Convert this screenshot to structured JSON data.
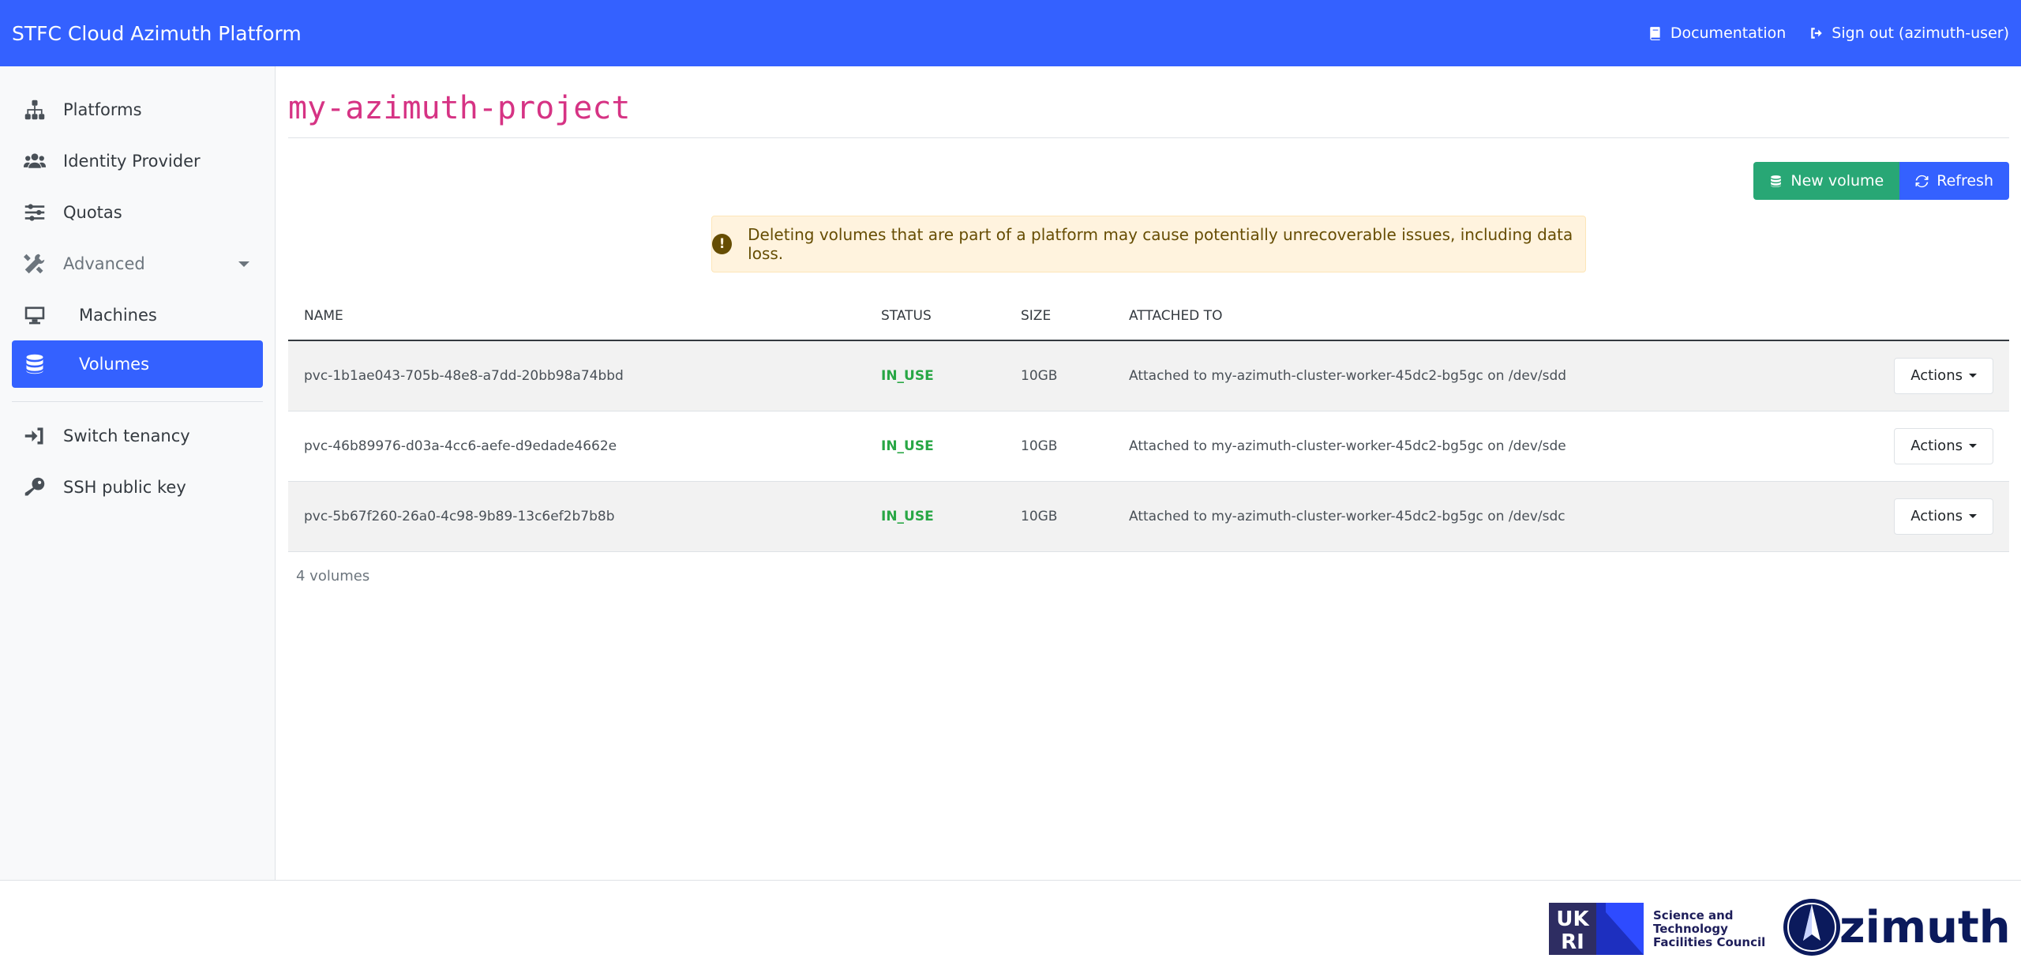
{
  "header": {
    "brand": "STFC Cloud Azimuth Platform",
    "documentation": "Documentation",
    "signout": "Sign out (azimuth-user)"
  },
  "sidebar": {
    "items": [
      {
        "label": "Platforms",
        "icon": "sitemap-icon"
      },
      {
        "label": "Identity Provider",
        "icon": "users-icon"
      },
      {
        "label": "Quotas",
        "icon": "sliders-icon"
      },
      {
        "label": "Advanced",
        "icon": "tools-icon"
      },
      {
        "label": "Machines",
        "icon": "desktop-icon"
      },
      {
        "label": "Volumes",
        "icon": "database-icon"
      },
      {
        "label": "Switch tenancy",
        "icon": "sign-in-icon"
      },
      {
        "label": "SSH public key",
        "icon": "key-icon"
      }
    ]
  },
  "main": {
    "title": "my-azimuth-project",
    "new_volume": "New volume",
    "refresh": "Refresh",
    "alert": "Deleting volumes that are part of a platform may cause potentially unrecoverable issues, including data loss.",
    "columns": [
      "NAME",
      "STATUS",
      "SIZE",
      "ATTACHED TO"
    ],
    "rows": [
      {
        "name": "pvc-1b1ae043-705b-48e8-a7dd-20bb98a74bbd",
        "status": "IN_USE",
        "size": "10GB",
        "attached": "Attached to my-azimuth-cluster-worker-45dc2-bg5gc on /dev/sdd",
        "actions": "Actions"
      },
      {
        "name": "pvc-46b89976-d03a-4cc6-aefe-d9edade4662e",
        "status": "IN_USE",
        "size": "10GB",
        "attached": "Attached to my-azimuth-cluster-worker-45dc2-bg5gc on /dev/sde",
        "actions": "Actions"
      },
      {
        "name": "pvc-5b67f260-26a0-4c98-9b89-13c6ef2b7b8b",
        "status": "IN_USE",
        "size": "10GB",
        "attached": "Attached to my-azimuth-cluster-worker-45dc2-bg5gc on /dev/sdc",
        "actions": "Actions"
      }
    ],
    "count": "4 volumes"
  },
  "footer": {
    "ukri_logo": "UKRI",
    "stfc": [
      "Science and",
      "Technology",
      "Facilities Council"
    ],
    "azimuth": "zimuth"
  },
  "colors": {
    "primary": "#3461ff",
    "success": "#28a775",
    "title": "#d63384"
  }
}
